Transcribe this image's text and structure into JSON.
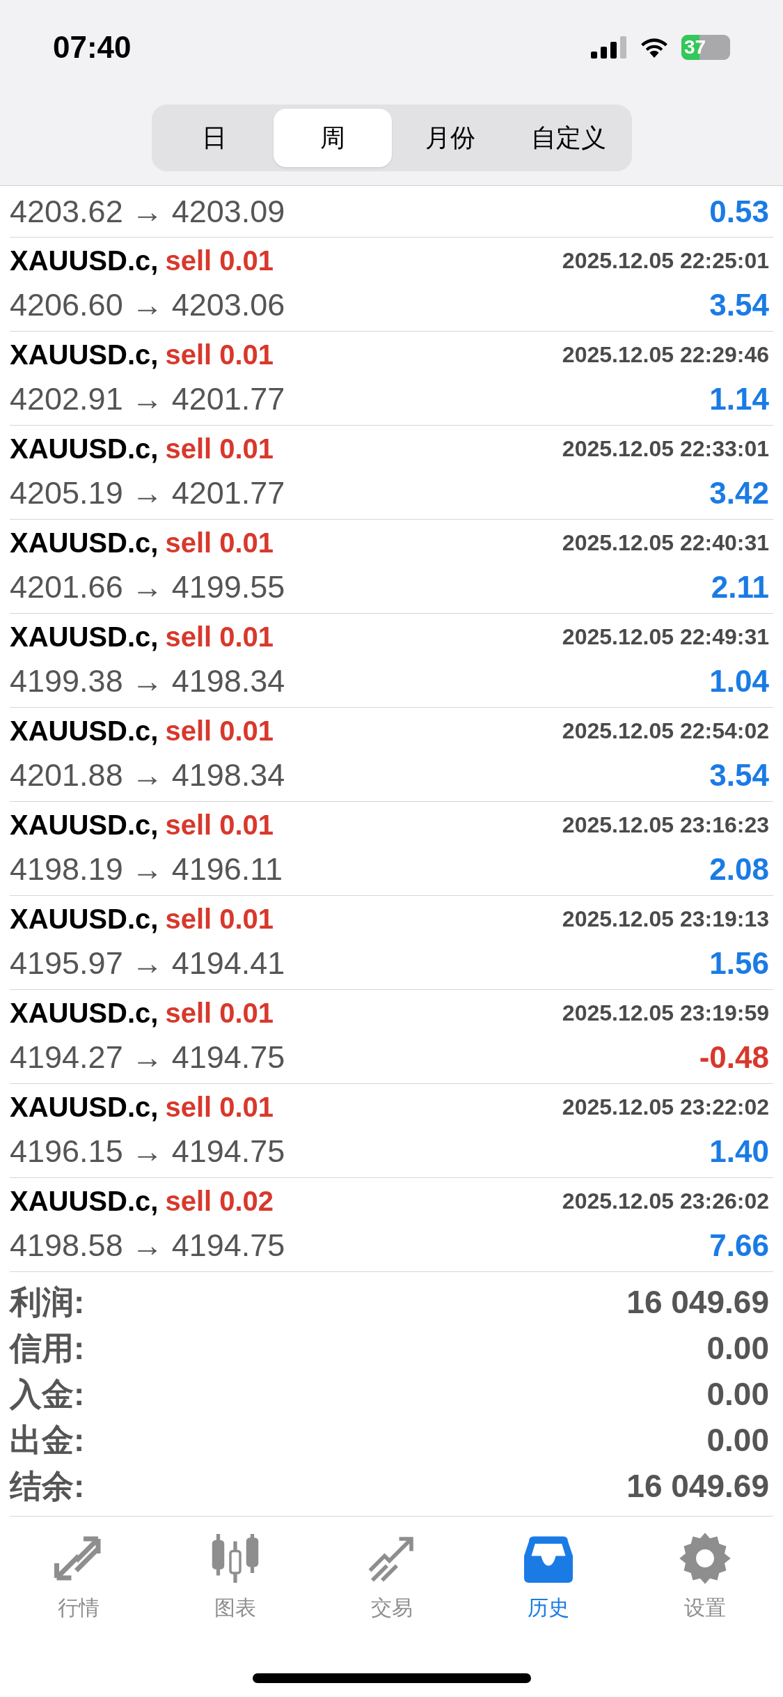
{
  "status_bar": {
    "time": "07:40",
    "battery": "37"
  },
  "period_tabs": [
    {
      "label": "日",
      "selected": false
    },
    {
      "label": "周",
      "selected": true
    },
    {
      "label": "月份",
      "selected": false
    },
    {
      "label": "自定义",
      "selected": false
    }
  ],
  "partial_row": {
    "price": "4203.62 → 4203.09",
    "profit": "0.53",
    "loss": false
  },
  "trades": [
    {
      "symbol": "XAUUSD.c,",
      "side": "sell 0.01",
      "time": "2025.12.05 22:25:01",
      "price": "4206.60 → 4203.06",
      "profit": "3.54",
      "loss": false
    },
    {
      "symbol": "XAUUSD.c,",
      "side": "sell 0.01",
      "time": "2025.12.05 22:29:46",
      "price": "4202.91 → 4201.77",
      "profit": "1.14",
      "loss": false
    },
    {
      "symbol": "XAUUSD.c,",
      "side": "sell 0.01",
      "time": "2025.12.05 22:33:01",
      "price": "4205.19 → 4201.77",
      "profit": "3.42",
      "loss": false
    },
    {
      "symbol": "XAUUSD.c,",
      "side": "sell 0.01",
      "time": "2025.12.05 22:40:31",
      "price": "4201.66 → 4199.55",
      "profit": "2.11",
      "loss": false
    },
    {
      "symbol": "XAUUSD.c,",
      "side": "sell 0.01",
      "time": "2025.12.05 22:49:31",
      "price": "4199.38 → 4198.34",
      "profit": "1.04",
      "loss": false
    },
    {
      "symbol": "XAUUSD.c,",
      "side": "sell 0.01",
      "time": "2025.12.05 22:54:02",
      "price": "4201.88 → 4198.34",
      "profit": "3.54",
      "loss": false
    },
    {
      "symbol": "XAUUSD.c,",
      "side": "sell 0.01",
      "time": "2025.12.05 23:16:23",
      "price": "4198.19 → 4196.11",
      "profit": "2.08",
      "loss": false
    },
    {
      "symbol": "XAUUSD.c,",
      "side": "sell 0.01",
      "time": "2025.12.05 23:19:13",
      "price": "4195.97 → 4194.41",
      "profit": "1.56",
      "loss": false
    },
    {
      "symbol": "XAUUSD.c,",
      "side": "sell 0.01",
      "time": "2025.12.05 23:19:59",
      "price": "4194.27 → 4194.75",
      "profit": "-0.48",
      "loss": true
    },
    {
      "symbol": "XAUUSD.c,",
      "side": "sell 0.01",
      "time": "2025.12.05 23:22:02",
      "price": "4196.15 → 4194.75",
      "profit": "1.40",
      "loss": false
    },
    {
      "symbol": "XAUUSD.c,",
      "side": "sell 0.02",
      "time": "2025.12.05 23:26:02",
      "price": "4198.58 → 4194.75",
      "profit": "7.66",
      "loss": false
    }
  ],
  "summary": [
    {
      "label": "利润:",
      "value": "16 049.69"
    },
    {
      "label": "信用:",
      "value": "0.00"
    },
    {
      "label": "入金:",
      "value": "0.00"
    },
    {
      "label": "出金:",
      "value": "0.00"
    },
    {
      "label": "结余:",
      "value": "16 049.69"
    }
  ],
  "tab_bar": [
    {
      "kind": "quotes",
      "label": "行情",
      "selected": false
    },
    {
      "kind": "chart",
      "label": "图表",
      "selected": false
    },
    {
      "kind": "trade",
      "label": "交易",
      "selected": false
    },
    {
      "kind": "history",
      "label": "历史",
      "selected": true
    },
    {
      "kind": "settings",
      "label": "设置",
      "selected": false
    }
  ]
}
